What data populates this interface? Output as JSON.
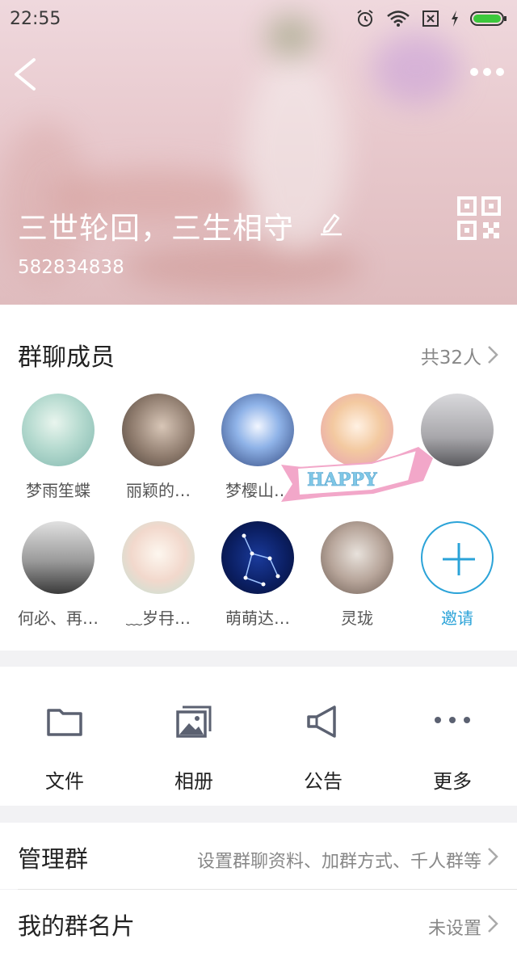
{
  "status_bar": {
    "time": "22:55",
    "icons": [
      "alarm-icon",
      "wifi-icon",
      "sim-icon",
      "charging-icon",
      "battery-icon"
    ],
    "battery_color": "#3cc83c"
  },
  "header": {
    "group_name": "三世轮回，三生相守",
    "group_id": "582834838"
  },
  "members": {
    "title": "群聊成员",
    "count": "共32人",
    "list": [
      {
        "name": "梦雨笙蝶"
      },
      {
        "name": "丽颖的…"
      },
      {
        "name": "梦樱山…"
      },
      {
        "name": ""
      },
      {
        "name": ""
      },
      {
        "name": "何必、再…"
      },
      {
        "name": "﹏岁冄…"
      },
      {
        "name": "萌萌达…"
      },
      {
        "name": "灵珑"
      }
    ],
    "invite_label": "邀请",
    "sticker_text": "HAPPY"
  },
  "actions": [
    {
      "label": "文件",
      "icon": "folder-icon"
    },
    {
      "label": "相册",
      "icon": "album-icon"
    },
    {
      "label": "公告",
      "icon": "megaphone-icon"
    },
    {
      "label": "更多",
      "icon": "more-dots-icon"
    }
  ],
  "rows": [
    {
      "label": "管理群",
      "value": "设置群聊资料、加群方式、千人群等"
    },
    {
      "label": "我的群名片",
      "value": "未设置"
    }
  ],
  "colors": {
    "accent": "#2ba3d8",
    "icon_gray": "#5b6171"
  }
}
